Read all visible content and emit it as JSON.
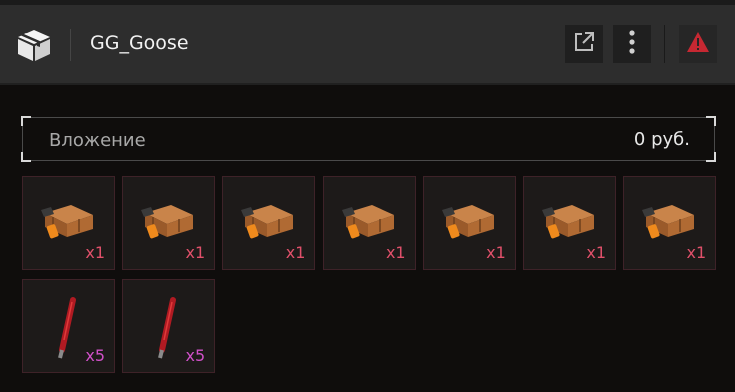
{
  "header": {
    "title": "GG_Goose",
    "icons": {
      "logo": "box-logo-icon",
      "external": "external-link-icon",
      "more": "more-vertical-icon",
      "warning": "warning-triangle-icon"
    }
  },
  "investment": {
    "label": "Вложение",
    "value": "0 руб."
  },
  "items": [
    {
      "type": "ammo-box",
      "quantity": "x1"
    },
    {
      "type": "ammo-box",
      "quantity": "x1"
    },
    {
      "type": "ammo-box",
      "quantity": "x1"
    },
    {
      "type": "ammo-box",
      "quantity": "x1"
    },
    {
      "type": "ammo-box",
      "quantity": "x1"
    },
    {
      "type": "ammo-box",
      "quantity": "x1"
    },
    {
      "type": "ammo-box",
      "quantity": "x1"
    },
    {
      "type": "flare-stick",
      "quantity": "x5"
    },
    {
      "type": "flare-stick",
      "quantity": "x5"
    }
  ],
  "colors": {
    "qty_box": "#e0506a",
    "qty_flare": "#d050c8",
    "warning": "#c62832",
    "slot_border": "#3e2228"
  }
}
